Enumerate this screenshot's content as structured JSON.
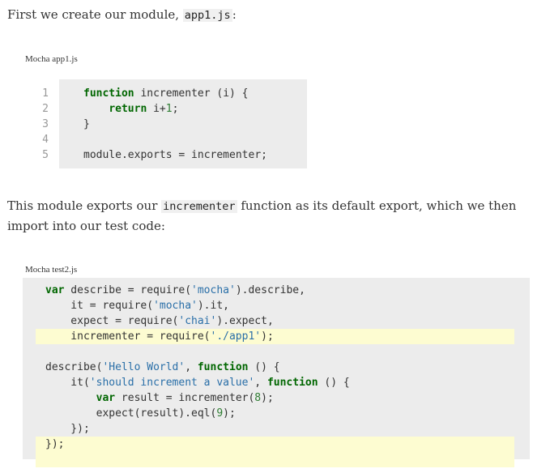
{
  "intro": {
    "before": "First we create our module, ",
    "code": "app1.js",
    "after": ":"
  },
  "caption1": "Mocha app1.js",
  "code1": {
    "line_numbers": [
      "1",
      "2",
      "3",
      "4",
      "5"
    ],
    "lines": [
      [
        {
          "t": "kw",
          "v": "function"
        },
        {
          "t": "p",
          "v": " incrementer (i) {"
        }
      ],
      [
        {
          "t": "p",
          "v": "    "
        },
        {
          "t": "kw",
          "v": "return"
        },
        {
          "t": "p",
          "v": " i+"
        },
        {
          "t": "num",
          "v": "1"
        },
        {
          "t": "p",
          "v": ";"
        }
      ],
      [
        {
          "t": "p",
          "v": "}"
        }
      ],
      [
        {
          "t": "p",
          "v": ""
        }
      ],
      [
        {
          "t": "p",
          "v": "module.exports = incrementer;"
        }
      ]
    ]
  },
  "para2": {
    "before": "This module exports our ",
    "code": "incrementer",
    "after": " function as its default export, which we then import into our test code:"
  },
  "caption2": "Mocha test2.js",
  "code2": {
    "highlighted_lines": [
      4,
      11,
      12
    ],
    "lines": [
      [
        {
          "t": "kw",
          "v": "var"
        },
        {
          "t": "p",
          "v": " describe = require("
        },
        {
          "t": "str",
          "v": "'mocha'"
        },
        {
          "t": "p",
          "v": ").describe,"
        }
      ],
      [
        {
          "t": "p",
          "v": "    it = require("
        },
        {
          "t": "str",
          "v": "'mocha'"
        },
        {
          "t": "p",
          "v": ").it,"
        }
      ],
      [
        {
          "t": "p",
          "v": "    expect = require("
        },
        {
          "t": "str",
          "v": "'chai'"
        },
        {
          "t": "p",
          "v": ").expect,"
        }
      ],
      [
        {
          "t": "p",
          "v": "    incrementer = require("
        },
        {
          "t": "str",
          "v": "'./app1'"
        },
        {
          "t": "p",
          "v": ");"
        }
      ],
      [
        {
          "t": "p",
          "v": ""
        }
      ],
      [
        {
          "t": "p",
          "v": "describe("
        },
        {
          "t": "str",
          "v": "'Hello World'"
        },
        {
          "t": "p",
          "v": ", "
        },
        {
          "t": "kw",
          "v": "function"
        },
        {
          "t": "p",
          "v": " () {"
        }
      ],
      [
        {
          "t": "p",
          "v": "    it("
        },
        {
          "t": "str",
          "v": "'should increment a value'"
        },
        {
          "t": "p",
          "v": ", "
        },
        {
          "t": "kw",
          "v": "function"
        },
        {
          "t": "p",
          "v": " () {"
        }
      ],
      [
        {
          "t": "p",
          "v": "        "
        },
        {
          "t": "kw",
          "v": "var"
        },
        {
          "t": "p",
          "v": " result = incrementer("
        },
        {
          "t": "num",
          "v": "8"
        },
        {
          "t": "p",
          "v": ");"
        }
      ],
      [
        {
          "t": "p",
          "v": "        expect(result).eql("
        },
        {
          "t": "num",
          "v": "9"
        },
        {
          "t": "p",
          "v": ");"
        }
      ],
      [
        {
          "t": "p",
          "v": "    });"
        }
      ],
      [
        {
          "t": "p",
          "v": "});"
        }
      ]
    ]
  },
  "colors": {
    "keyword": "#006600",
    "string": "#2a6fa8",
    "number": "#2e7d32",
    "highlight": "#fdfcd1",
    "code_bg": "#ececec"
  }
}
